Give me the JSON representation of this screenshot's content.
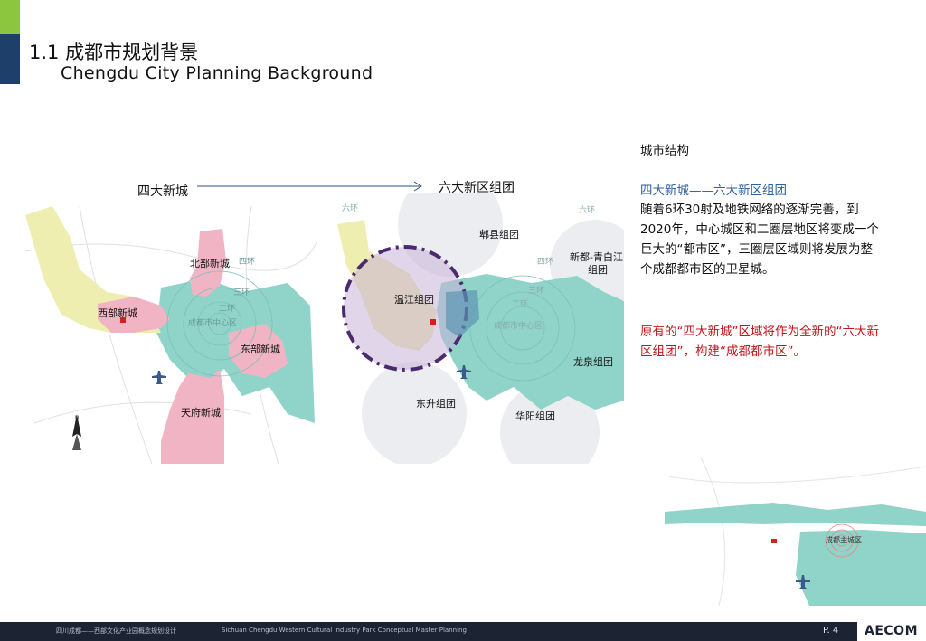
{
  "header": {
    "title_cn": "1.1 成都市规划背景",
    "title_en": "Chengdu City Planning Background"
  },
  "maps": {
    "left_label": "四大新城",
    "right_label": "六大新区组团",
    "left": {
      "north": "北部新城",
      "west": "西部新城",
      "east": "东部新城",
      "south": "天府新城",
      "ring4": "四环",
      "ring3": "三环",
      "ring2": "二环",
      "center": "成都市中心区",
      "north_arrow": "N"
    },
    "right": {
      "ring6": "六环",
      "ring4": "四环",
      "ring3": "三环",
      "ring2": "二环",
      "pi": "郫县组团",
      "xindu": "新都-青白江",
      "xindu2": "组团",
      "wenjiang": "温江组团",
      "center": "成都市中心区",
      "longquan": "龙泉组团",
      "dongsheng": "东升组团",
      "huayang": "华阳组团"
    },
    "small": {
      "label": "成都主城区"
    }
  },
  "sidebar": {
    "heading": "城市结构",
    "subheading": "四大新城——六大新区组团",
    "body": "随着6环30射及地铁网络的逐渐完善，到2020年，中心城区和二圈层地区将变成一个巨大的“都市区”，三圈层区域则将发展为整个成都都市区的卫星城。",
    "note": "原有的“四大新城”区域将作为全新的“六大新区组团”，构建“成都都市区”。"
  },
  "footer": {
    "project_cn": "四川成都——西部文化产业园概念规划设计",
    "project_en": "Sichuan Chengdu Western Cultural Industry Park Conceptual Master Planning",
    "page": "P. 4",
    "logo": "AECOM"
  },
  "colors": {
    "green": "#8cc63f",
    "navy": "#1f3f6b",
    "teal": "#8fd3c9",
    "pink": "#f0b4c4",
    "yellow": "#eeeeb0",
    "purple": "#4b2a6e",
    "red_text": "#c0161c",
    "blue_text": "#2f5f9e"
  }
}
